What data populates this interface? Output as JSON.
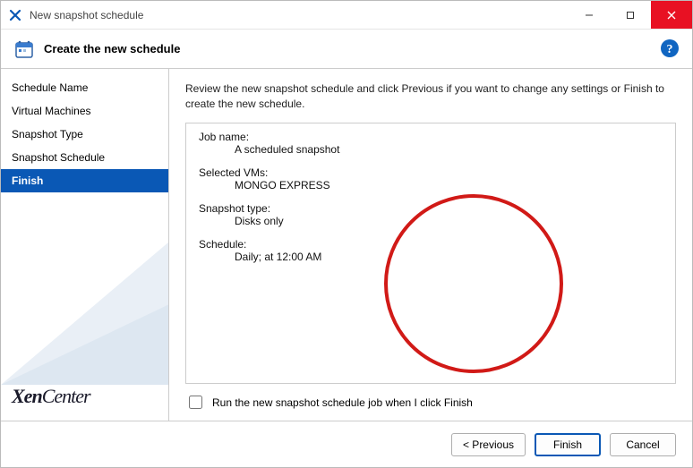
{
  "window": {
    "title": "New snapshot schedule"
  },
  "header": {
    "title": "Create the new schedule"
  },
  "sidebar": {
    "items": [
      {
        "label": "Schedule Name",
        "active": false
      },
      {
        "label": "Virtual Machines",
        "active": false
      },
      {
        "label": "Snapshot Type",
        "active": false
      },
      {
        "label": "Snapshot Schedule",
        "active": false
      },
      {
        "label": "Finish",
        "active": true
      }
    ],
    "brand_bold": "Xen",
    "brand_rest": "Center"
  },
  "content": {
    "instruction": "Review the new snapshot schedule and click Previous if you want to change any settings or Finish to create the new schedule.",
    "summary": {
      "job_name_label": "Job name:",
      "job_name_value": "A scheduled snapshot",
      "selected_vms_label": "Selected VMs:",
      "selected_vms_value": "MONGO EXPRESS",
      "snapshot_type_label": "Snapshot type:",
      "snapshot_type_value": "Disks only",
      "schedule_label": "Schedule:",
      "schedule_value": "Daily; at 12:00 AM"
    },
    "run_checkbox_label": "Run the new snapshot schedule job when I click Finish",
    "run_checkbox_checked": false
  },
  "footer": {
    "previous": "< Previous",
    "finish": "Finish",
    "cancel": "Cancel"
  }
}
